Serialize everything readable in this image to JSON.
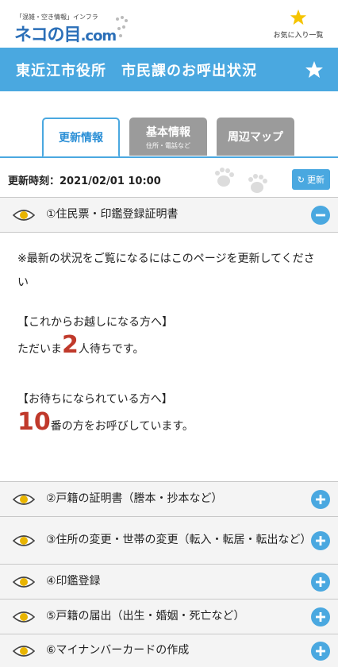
{
  "header": {
    "logo_tagline": "「混雑・空き情報」インフラ",
    "logo_main": "ネコの目",
    "logo_suffix": ".com",
    "favorites_label": "お気に入り一覧"
  },
  "title_bar": {
    "title": "東近江市役所　市民課のお呼出状況"
  },
  "tabs": [
    {
      "label": "更新情報",
      "sub": ""
    },
    {
      "label": "基本情報",
      "sub": "住所・電話など"
    },
    {
      "label": "周辺マップ",
      "sub": ""
    }
  ],
  "update": {
    "time_text": "更新時刻：2021/02/01 10:00",
    "refresh_label": "更新"
  },
  "sections": [
    {
      "label": "①住民票・印鑑登録証明書",
      "expanded": true
    },
    {
      "label": "②戸籍の証明書（謄本・抄本など）",
      "expanded": false
    },
    {
      "label": "③住所の変更・世帯の変更（転入・転居・転出など）",
      "expanded": false
    },
    {
      "label": "④印鑑登録",
      "expanded": false
    },
    {
      "label": "⑤戸籍の届出（出生・婚姻・死亡など）",
      "expanded": false
    },
    {
      "label": "⑥マイナンバーカードの作成",
      "expanded": false
    }
  ],
  "detail": {
    "notice": "※最新の状況をご覧になるにはこのページを更新してください",
    "upcoming_heading": "【これからお越しになる方へ】",
    "upcoming_prefix": "ただいま",
    "waiting_count": "2",
    "upcoming_suffix": "人待ちです。",
    "waiting_heading": "【お待ちになられている方へ】",
    "now_calling": "10",
    "waiting_suffix": "番の方をお呼びしています。"
  },
  "colors": {
    "accent": "#4aa8e0",
    "highlight_number": "#c0392b",
    "star": "#f5c400"
  }
}
